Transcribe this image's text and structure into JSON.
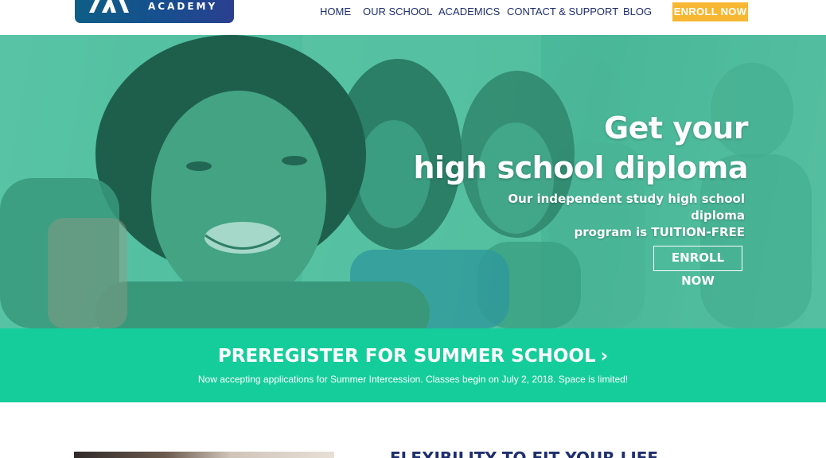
{
  "header": {
    "logo_text": "ACADEMY",
    "nav": [
      {
        "label": "HOME"
      },
      {
        "label": "OUR SCHOOL"
      },
      {
        "label": "ACADEMICS"
      },
      {
        "label": "CONTACT & SUPPORT"
      },
      {
        "label": "BLOG"
      }
    ],
    "enroll_button": "ENROLL NOW"
  },
  "hero": {
    "title_line1": "Get your",
    "title_line2": "high school diploma",
    "subtitle_line1": "Our independent study high school diploma",
    "subtitle_line2": "program is TUITION-FREE",
    "button": "ENROLL NOW"
  },
  "banner": {
    "title": "PREREGISTER FOR SUMMER SCHOOL",
    "chevron": "›",
    "text": "Now accepting applications for Summer Intercession. Classes begin on July 2, 2018. Space is limited!"
  },
  "section": {
    "heading": "FLEXIBILITY TO FIT YOUR LIFE"
  },
  "colors": {
    "nav_text": "#1f2f6e",
    "enroll_button": "#f7b733",
    "banner": "#15cd9b",
    "hero_overlay": "#4eb497"
  }
}
